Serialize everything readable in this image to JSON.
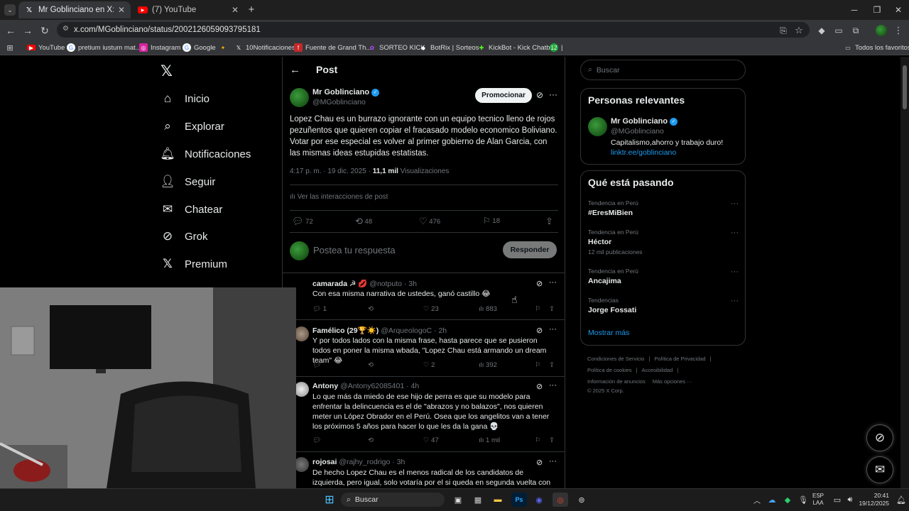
{
  "browser": {
    "tabs": [
      {
        "label": "Mr Goblinciano en X: \"Lopez Ch",
        "icon": "x-logo-icon"
      },
      {
        "label": "(7) YouTube",
        "icon": "youtube-icon"
      }
    ],
    "url": "x.com/MGoblinciano/status/2002126059093795181",
    "bookmarks": [
      "YouTube",
      "pretium iustum mat...",
      "Instagram",
      "Google",
      "10Notificaciones",
      "Fuente de Grand Th...",
      "SORTEO KICK",
      "BotRix | Sorteos",
      "KickBot - Kick Chatb...",
      "|"
    ],
    "bookmark_badge": "12",
    "all_bookmarks": "Todos los favoritos"
  },
  "nav": {
    "items": [
      {
        "label": "Inicio",
        "icon": "home-icon"
      },
      {
        "label": "Explorar",
        "icon": "search-icon"
      },
      {
        "label": "Notificaciones",
        "icon": "bell-icon"
      },
      {
        "label": "Seguir",
        "icon": "follow-icon"
      },
      {
        "label": "Chatear",
        "icon": "mail-icon"
      },
      {
        "label": "Grok",
        "icon": "grok-icon"
      },
      {
        "label": "Premium",
        "icon": "x-logo-icon"
      }
    ]
  },
  "post": {
    "header_title": "Post",
    "author_name": "Mr Goblinciano",
    "author_handle": "@MGoblinciano",
    "promote_label": "Promocionar",
    "text": "Lopez Chau es un burrazo ignorante con un equipo tecnico lleno de rojos pezuñentos que quieren copiar el fracasado modelo economico Boliviano. Votar por ese especial es volver al primer gobierno de Alan Garcia, con las mismas ideas estupidas estatistas.",
    "time": "4:17 p. m. · 19 dic. 2025 · ",
    "views_count": "11,1 mil",
    "views_label": " Visualizaciones",
    "interactions_label": "Ver las interacciones de post",
    "replies": "72",
    "reposts": "48",
    "likes": "476",
    "bookmarks": "18",
    "reply_placeholder": "Postea tu respuesta",
    "reply_button": "Responder"
  },
  "replies": [
    {
      "name": "camarada ☭ 💋",
      "handle": "@notputo · 3h",
      "text": "Con esa misma narrativa de ustedes, ganó castillo 😂",
      "replies": "1",
      "reposts": "",
      "likes": "23",
      "views": "883"
    },
    {
      "name": "Famélico (29🏆☀️)",
      "handle": "@ArqueologoC · 2h",
      "text": "Y por todos lados con la misma frase, hasta parece que se pusieron todos en poner la misma wbada, \"Lopez Chau está armando un dream team\" 😂",
      "replies": "",
      "reposts": "",
      "likes": "2",
      "views": "392"
    },
    {
      "name": "Antony",
      "handle": "@Antony62085401 · 4h",
      "text": "Lo que más da miedo de ese hijo de perra es que su modelo para enfrentar la delincuencia es el de \"abrazos y no balazos\", nos quieren meter un López Obrador en el Perú.  Osea que los angelitos van a tener los próximos 5 años para hacer lo que les da la gana 💀",
      "replies": "",
      "reposts": "",
      "likes": "47",
      "views": "1 mil"
    },
    {
      "name": "rojosai",
      "handle": "@rajhy_rodrigo · 3h",
      "text": "De hecho Lopez Chau es el menos radical de los candidatos de izquierda, pero igual, solo votaría por el si queda en segunda vuelta con un extremista"
    }
  ],
  "sidebar": {
    "search_placeholder": "Buscar",
    "relevant_title": "Personas relevantes",
    "relevant_name": "Mr Goblinciano",
    "relevant_handle": "@MGoblinciano",
    "relevant_bio": "Capitalismo,ahorro y trabajo duro!",
    "relevant_link": "linktr.ee/goblinciano",
    "trends_title": "Qué está pasando",
    "trends": [
      {
        "meta": "Tendencia en Perú",
        "name": "#EresMiBien",
        "count": ""
      },
      {
        "meta": "Tendencia en Perú",
        "name": "Héctor",
        "count": "12 mil publicaciones"
      },
      {
        "meta": "Tendencia en Perú",
        "name": "Ancajima",
        "count": ""
      },
      {
        "meta": "Tendencias",
        "name": "Jorge Fossati",
        "count": ""
      }
    ],
    "show_more": "Mostrar más",
    "footer": [
      "Condiciones de Servicio",
      "|",
      "Política de Privacidad",
      "|",
      "Política de cookies",
      "|",
      "Accesibilidad",
      "|",
      "Información de anuncios",
      "Más opciones ···",
      "© 2025 X Corp."
    ]
  },
  "taskbar": {
    "search_label": "Buscar",
    "lang_top": "ESP",
    "lang_bottom": "LAA",
    "time": "20:41",
    "date": "19/12/2025"
  },
  "colors": {
    "accent": "#1d9bf0",
    "background": "#000000",
    "border": "#2f3336",
    "muted": "#71767b"
  }
}
